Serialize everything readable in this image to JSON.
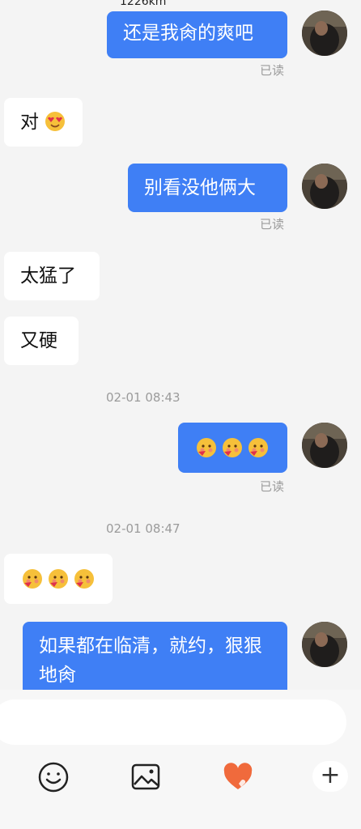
{
  "header": {
    "distance": "1226km"
  },
  "messages": [
    {
      "text": "还是我肏的爽吧",
      "read": "已读"
    },
    {
      "text": "对"
    },
    {
      "text": "别看没他俩大",
      "read": "已读"
    },
    {
      "text": "太猛了"
    },
    {
      "text": "又硬"
    },
    {
      "timestamp": "02-01 08:43"
    },
    {
      "read": "已读"
    },
    {
      "timestamp": "02-01 08:47"
    },
    {
      "text": "如果都在临清，就约，狠狠地肏"
    }
  ],
  "toolbar": {
    "plus_label": "+"
  },
  "icons": {
    "emoji": "smiley-icon",
    "image": "image-icon",
    "heart": "heart-icon",
    "plus": "plus-icon"
  },
  "colors": {
    "outgoing_bubble": "#3f7ff5",
    "incoming_bubble": "#ffffff",
    "heart": "#f06a3c"
  }
}
